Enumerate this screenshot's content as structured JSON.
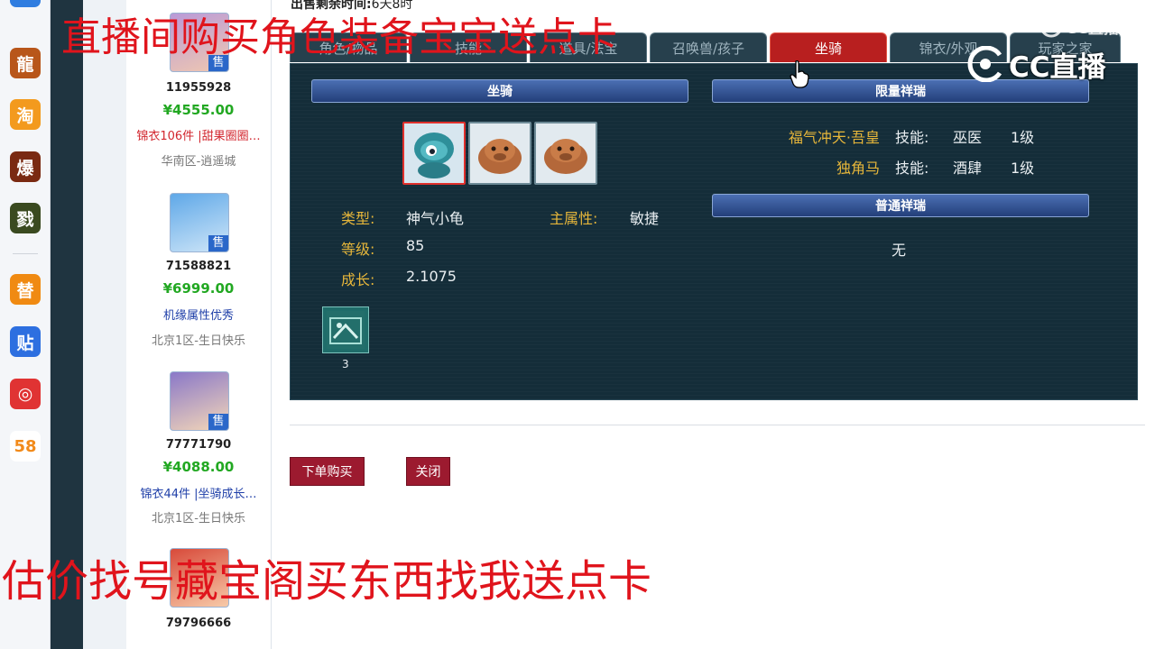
{
  "overlay": {
    "top_caption": "直播间购买角色装备宝宝送点卡",
    "bottom_caption": "估价找号藏宝阁买东西找我送点卡",
    "watermark_large": "CC直播",
    "watermark_small": "CC直播"
  },
  "header_strip": {
    "sale_time_label": "出售剩余时间:",
    "sale_time_value": "6天8时"
  },
  "dock": {
    "items": [
      {
        "name": "game-icon-1",
        "glyph": "龍",
        "color": "#b8561a"
      },
      {
        "name": "taobao-icon",
        "glyph": "淘",
        "color": "#f39a1e"
      },
      {
        "name": "game-icon-2",
        "glyph": "爆",
        "color": "#7a2a12"
      },
      {
        "name": "game-icon-3",
        "glyph": "戮",
        "color": "#3a4a20"
      },
      {
        "name": "app-icon-orange",
        "glyph": "替",
        "color": "#f08a12"
      },
      {
        "name": "tieba-icon",
        "glyph": "贴",
        "color": "#2d6fe0"
      },
      {
        "name": "netease-music-icon",
        "glyph": "◎",
        "color": "#e03333"
      },
      {
        "name": "58-icon",
        "glyph": "58",
        "color": "#ffffff"
      }
    ]
  },
  "listings": [
    {
      "id": "11955928",
      "price": "¥4555.00",
      "tag": "锦衣106件 |甜果圈圈…",
      "tag_color": "#d2262e",
      "server": "华南区-逍遥城"
    },
    {
      "id": "71588821",
      "price": "¥6999.00",
      "tag": "机缘属性优秀",
      "tag_color": "#1f3fa8",
      "server": "北京1区-生日快乐"
    },
    {
      "id": "77771790",
      "price": "¥4088.00",
      "tag": "锦衣44件 |坐骑成长…",
      "tag_color": "#1f3fa8",
      "server": "北京1区-生日快乐"
    },
    {
      "id": "79796666",
      "price": "",
      "tag": "",
      "tag_color": "#1f3fa8",
      "server": ""
    }
  ],
  "sale_badge": "售",
  "tabs": [
    {
      "label": "角色/物品",
      "active": false
    },
    {
      "label": "技能",
      "active": false
    },
    {
      "label": "道具/法宝",
      "active": false
    },
    {
      "label": "召唤兽/孩子",
      "active": false
    },
    {
      "label": "坐骑",
      "active": true
    },
    {
      "label": "锦衣/外观",
      "active": false
    },
    {
      "label": "玩家之家",
      "active": false
    }
  ],
  "mount_panel": {
    "left_header": "坐骑",
    "right_header_limited": "限量祥瑞",
    "right_header_normal": "普通祥瑞",
    "type_label": "类型:",
    "type_value": "神气小龟",
    "main_attr_label": "主属性:",
    "main_attr_value": "敏捷",
    "level_label": "等级:",
    "level_value": "85",
    "growth_label": "成长:",
    "growth_value": "2.1075",
    "item_count": "3",
    "limited_xiangrui": [
      {
        "name": "福气冲天·吾皇",
        "skill_label": "技能:",
        "skill": "巫医",
        "level": "1级"
      },
      {
        "name": "独角马",
        "skill_label": "技能:",
        "skill": "酒肆",
        "level": "1级"
      }
    ],
    "normal_xiangrui_value": "无"
  },
  "actions": {
    "buy_label": "下单购买",
    "close_label": "关闭"
  }
}
